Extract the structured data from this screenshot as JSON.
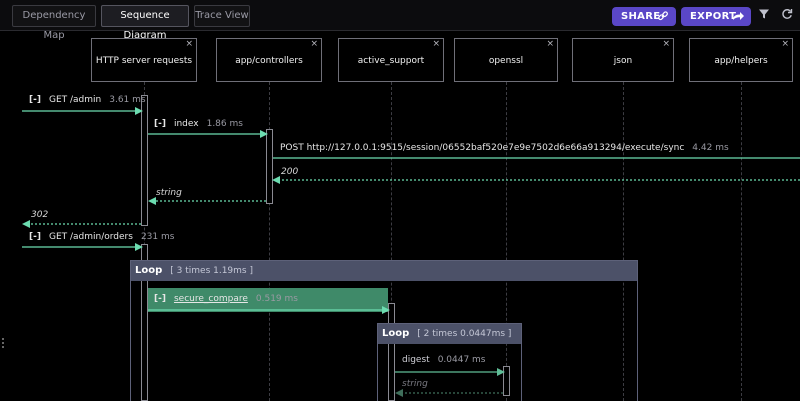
{
  "tabs": [
    {
      "label": "Dependency Map",
      "active": false
    },
    {
      "label": "Sequence Diagram",
      "active": true
    },
    {
      "label": "Trace View",
      "active": false
    }
  ],
  "toolbar": {
    "share_label": "SHARE",
    "export_label": "EXPORT",
    "filter_icon": "filter-icon",
    "reload_icon": "reload-icon",
    "accent": "#5a47c7"
  },
  "lifelines": [
    {
      "label": "HTTP server requests",
      "close": "×"
    },
    {
      "label": "app/controllers",
      "close": "×"
    },
    {
      "label": "active_support",
      "close": "×"
    },
    {
      "label": "openssl",
      "close": "×"
    },
    {
      "label": "json",
      "close": "×"
    },
    {
      "label": "app/helpers",
      "close": "×"
    }
  ],
  "messages": [
    {
      "toggle": "[-]",
      "label": "GET /admin",
      "time": "3.61 ms"
    },
    {
      "toggle": "[-]",
      "label": "index",
      "time": "1.86 ms"
    },
    {
      "label": "POST http://127.0.0.1:9515/session/06552baf520e7e9e7502d6e66a913294/execute/sync",
      "time": "4.42 ms"
    },
    {
      "toggle": "[-]",
      "label": "GET /admin/orders",
      "time": "231 ms"
    },
    {
      "toggle": "[-]",
      "label": "secure_compare",
      "time": "0.519 ms"
    },
    {
      "label": "digest",
      "time": "0.0447 ms"
    }
  ],
  "returns": [
    "200",
    "string",
    "302",
    "string"
  ],
  "loops": [
    {
      "title": "Loop",
      "detail": "[ 3 times 1.19ms ]"
    },
    {
      "title": "Loop",
      "detail": "[ 2 times 0.0447ms ]"
    }
  ],
  "colors": {
    "arrow": "#6cdcb0",
    "loop_header": "#4c5168",
    "highlight": "#3f8a69"
  }
}
